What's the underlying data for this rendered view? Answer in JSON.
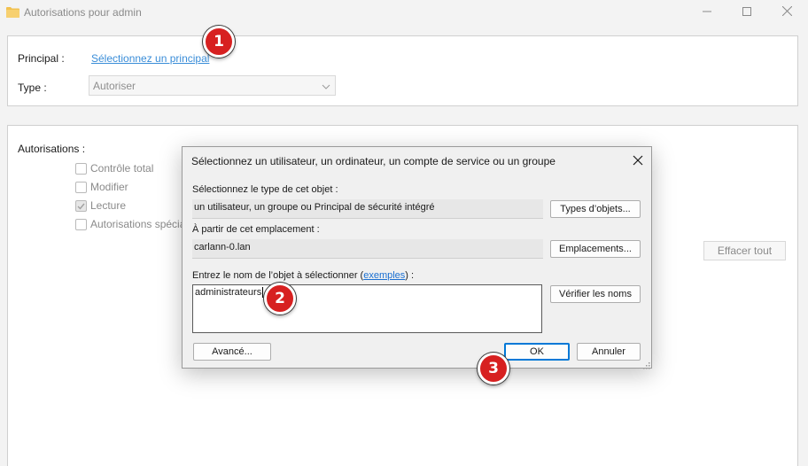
{
  "window": {
    "title": "Autorisations pour admin"
  },
  "principal": {
    "label": "Principal :",
    "link": "Sélectionnez un principal"
  },
  "type": {
    "label": "Type :",
    "value": "Autoriser"
  },
  "permissions": {
    "label": "Autorisations :",
    "items": [
      {
        "label": "Contrôle total",
        "checked": false
      },
      {
        "label": "Modifier",
        "checked": false
      },
      {
        "label": "Lecture",
        "checked": true
      },
      {
        "label": "Autorisations spécia",
        "checked": false
      }
    ],
    "clear_button": "Effacer tout"
  },
  "dialog": {
    "title": "Sélectionnez un utilisateur, un ordinateur, un compte de service ou un groupe",
    "object_type_label": "Sélectionnez le type de cet objet :",
    "object_type_value": "un utilisateur, un groupe ou Principal de sécurité intégré",
    "object_types_button": "Types d’objets...",
    "location_label": "À partir de cet emplacement :",
    "location_value": "carlann-0.lan",
    "locations_button": "Emplacements...",
    "name_label_before": "Entrez le nom de l’objet à sélectionner (",
    "name_label_link": "exemples",
    "name_label_after": ") :",
    "name_value": "administrateurs",
    "check_names_button": "Vérifier les noms",
    "advanced_button": "Avancé...",
    "ok_button": "OK",
    "cancel_button": "Annuler"
  },
  "steps": [
    "1",
    "2",
    "3"
  ],
  "colors": {
    "badge": "#d72020",
    "link": "#3a8dd8",
    "ok_border": "#0078d7",
    "folder": "#f2c14e"
  }
}
